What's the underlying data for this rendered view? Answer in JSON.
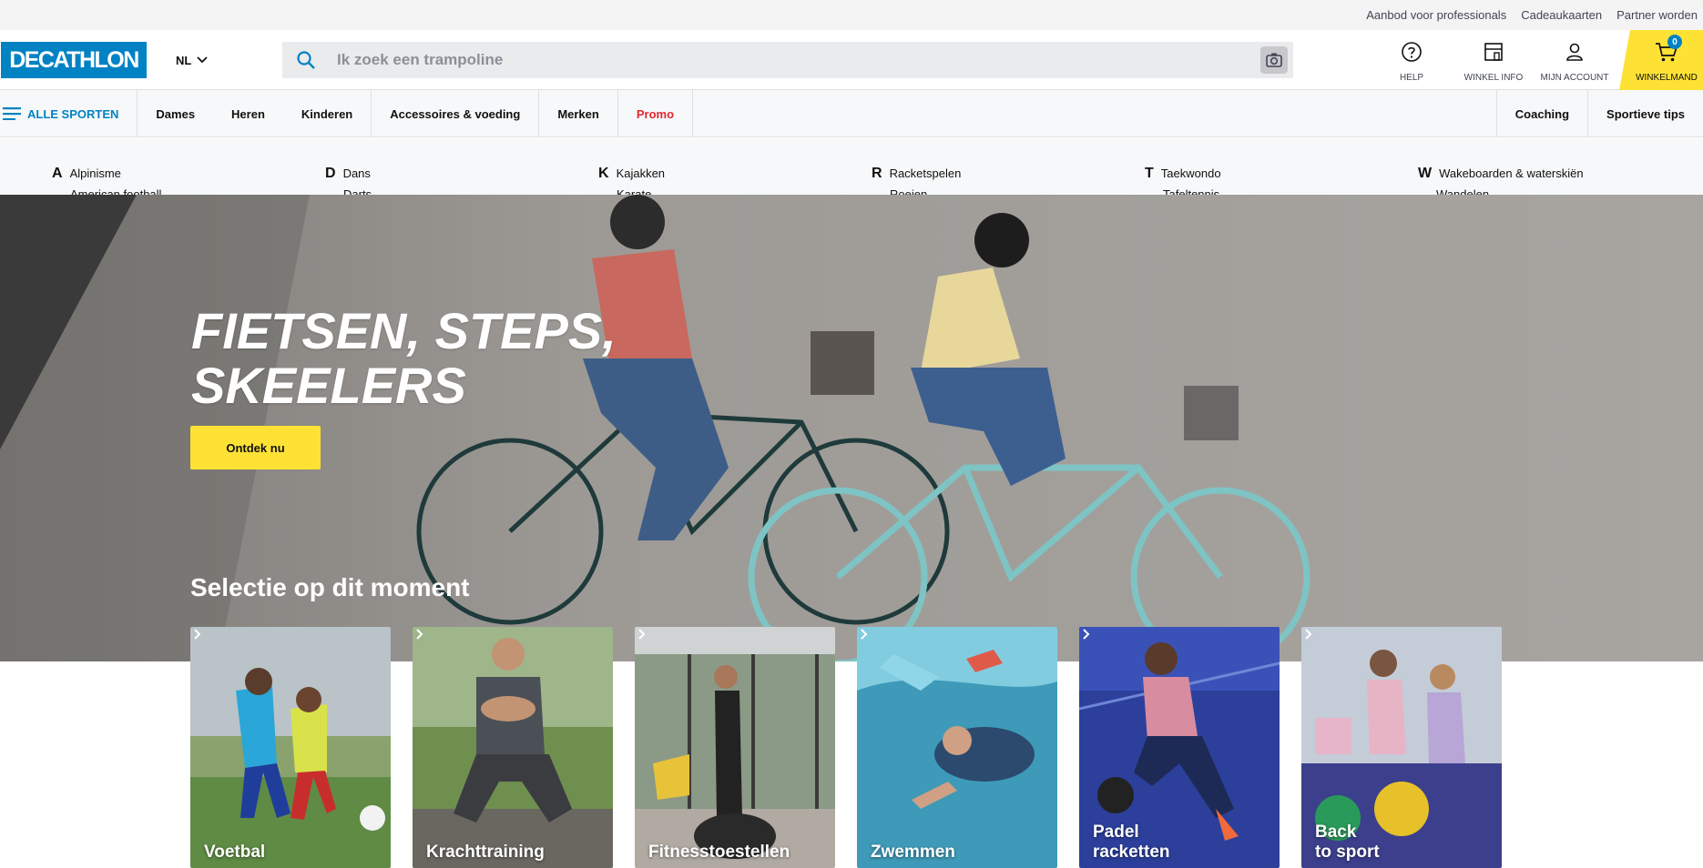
{
  "utility": {
    "links": [
      "Aanbod voor professionals",
      "Cadeaukaarten",
      "Partner worden"
    ]
  },
  "header": {
    "logo_text": "DECATHLON",
    "language": "NL",
    "search_placeholder": "Ik zoek een trampoline",
    "help_label": "HELP",
    "store_label": "WINKEL INFO",
    "account_label": "MIJN ACCOUNT",
    "cart_label": "WINKELMAND",
    "cart_count": "0"
  },
  "nav": {
    "all_sports": "ALLE SPORTEN",
    "items": [
      "Dames",
      "Heren",
      "Kinderen",
      "Accessoires & voeding",
      "Merken",
      "Promo"
    ],
    "right_items": [
      "Coaching",
      "Sportieve tips"
    ]
  },
  "mega_menu": {
    "columns": [
      {
        "letter": "A",
        "sport": "Alpinisme",
        "next": "American football"
      },
      {
        "letter": "D",
        "sport": "Dans",
        "next": "Darts"
      },
      {
        "letter": "K",
        "sport": "Kajakken",
        "next": "Karate"
      },
      {
        "letter": "R",
        "sport": "Racketspelen",
        "next": "Roeien"
      },
      {
        "letter": "T",
        "sport": "Taekwondo",
        "next": "Tafeltennis"
      },
      {
        "letter": "W",
        "sport": "Wakeboarden & waterskiën",
        "next": "Wandelen"
      }
    ]
  },
  "hero": {
    "title_line1": "FIETSEN, STEPS,",
    "title_line2": "SKEELERS",
    "cta": "Ontdek nu",
    "section_title": "Selectie op dit moment"
  },
  "cards": [
    {
      "line1": "Voetbal",
      "line2": ""
    },
    {
      "line1": "Krachttraining",
      "line2": ""
    },
    {
      "line1": "Fitnesstoestellen",
      "line2": ""
    },
    {
      "line1": "Zwemmen",
      "line2": ""
    },
    {
      "line1": "Padel",
      "line2": "racketten"
    },
    {
      "line1": "Back",
      "line2": "to sport"
    }
  ],
  "colors": {
    "brand_blue": "#0082c3",
    "accent_yellow": "#fde235",
    "promo_red": "#e3262f"
  }
}
